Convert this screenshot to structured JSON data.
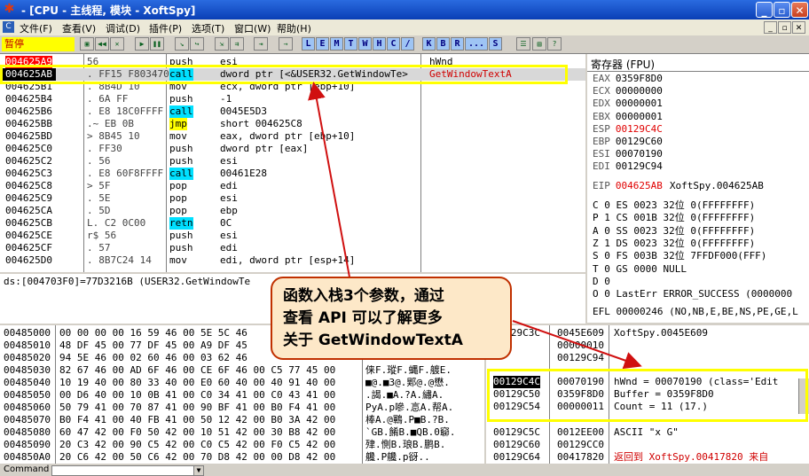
{
  "title_bar": {
    "title": "- [CPU - 主线程, 模块 - XoftSpy]",
    "minimize": "_",
    "restore": "▫",
    "close": "✕"
  },
  "menu": {
    "items": [
      "文件(F)",
      "查看(V)",
      "调试(D)",
      "插件(P)",
      "选项(T)",
      "窗口(W)",
      "帮助(H)"
    ]
  },
  "toolbar": {
    "status": "暂停",
    "letters": [
      "L",
      "E",
      "M",
      "T",
      "W",
      "H",
      "C",
      "/",
      "K",
      "B",
      "R",
      "...",
      "S"
    ]
  },
  "disasm": {
    "rows": [
      {
        "addr": "004625A9",
        "hex": "  56",
        "mn": "push",
        "opr": "esi",
        "cmt": "hWnd"
      },
      {
        "addr": "004625AB",
        "hex": ".  FF15 F8034700",
        "mn": "call",
        "opr": "dword ptr [<&USER32.GetWindowTe>",
        "cmt": "GetWindowTextA"
      },
      {
        "addr": "004625B1",
        "hex": ".  8B4D 10",
        "mn": "mov",
        "opr": "ecx, dword ptr [ebp+10]",
        "cmt": ""
      },
      {
        "addr": "004625B4",
        "hex": ".  6A FF",
        "mn": "push",
        "opr": "-1",
        "cmt": ""
      },
      {
        "addr": "004625B6",
        "hex": ".  E8 18C0FFFF",
        "mn": "call",
        "opr": "0045E5D3",
        "cmt": ""
      },
      {
        "addr": "004625BB",
        "hex": ".~ EB 0B",
        "mn": "jmp",
        "opr": "short 004625C8",
        "cmt": ""
      },
      {
        "addr": "004625BD",
        "hex": ">  8B45 10",
        "mn": "mov",
        "opr": "eax, dword ptr [ebp+10]",
        "cmt": ""
      },
      {
        "addr": "004625C0",
        "hex": ".  FF30",
        "mn": "push",
        "opr": "dword ptr [eax]",
        "cmt": ""
      },
      {
        "addr": "004625C2",
        "hex": ".  56",
        "mn": "push",
        "opr": "esi",
        "cmt": ""
      },
      {
        "addr": "004625C3",
        "hex": ".  E8 60F8FFFF",
        "mn": "call",
        "opr": "00461E28",
        "cmt": ""
      },
      {
        "addr": "004625C8",
        "hex": ">  5F",
        "mn": "pop",
        "opr": "edi",
        "cmt": ""
      },
      {
        "addr": "004625C9",
        "hex": ".  5E",
        "mn": "pop",
        "opr": "esi",
        "cmt": ""
      },
      {
        "addr": "004625CA",
        "hex": ".  5D",
        "mn": "pop",
        "opr": "ebp",
        "cmt": ""
      },
      {
        "addr": "004625CB",
        "hex": "L. C2 0C00",
        "mn": "retn",
        "opr": "0C",
        "cmt": ""
      },
      {
        "addr": "004625CE",
        "hex": "r$ 56",
        "mn": "push",
        "opr": "esi",
        "cmt": ""
      },
      {
        "addr": "004625CF",
        "hex": ".  57",
        "mn": "push",
        "opr": "edi",
        "cmt": ""
      },
      {
        "addr": "004625D0",
        "hex": ".  8B7C24 14",
        "mn": "mov",
        "opr": "edi, dword ptr [esp+14]",
        "cmt": ""
      }
    ]
  },
  "info_line": "ds:[004703F0]=77D3216B (USER32.GetWindowTe",
  "registers": {
    "header": "寄存器 (FPU)",
    "general": [
      {
        "name": "EAX",
        "val": "0359F8D0",
        "extra": ""
      },
      {
        "name": "ECX",
        "val": "00000000",
        "extra": ""
      },
      {
        "name": "EDX",
        "val": "00000001",
        "extra": ""
      },
      {
        "name": "EBX",
        "val": "00000001",
        "extra": ""
      },
      {
        "name": "ESP",
        "val": "00129C4C",
        "extra": ""
      },
      {
        "name": "EBP",
        "val": "00129C60",
        "extra": ""
      },
      {
        "name": "ESI",
        "val": "00070190",
        "extra": ""
      },
      {
        "name": "EDI",
        "val": "00129C94",
        "extra": ""
      }
    ],
    "eip": {
      "name": "EIP",
      "val": "004625AB",
      "extra": "XoftSpy.004625AB"
    },
    "flags": [
      "C 0  ES 0023 32位 0(FFFFFFFF)",
      "P 1  CS 001B 32位 0(FFFFFFFF)",
      "A 0  SS 0023 32位 0(FFFFFFFF)",
      "Z 1  DS 0023 32位 0(FFFFFFFF)",
      "S 0  FS 003B 32位 7FFDF000(FFF)",
      "T 0  GS 0000 NULL",
      "D 0",
      "O 0  LastErr ERROR_SUCCESS (0000000"
    ],
    "efl": "EFL 00000246 (NO,NB,E,BE,NS,PE,GE,L"
  },
  "dump": {
    "rows": [
      {
        "addr": "00485000",
        "hex": "00 00 00 00 16 59 46 00 5E 5C 46",
        "ascii": ""
      },
      {
        "addr": "00485010",
        "hex": "48 DF 45 00 77 DF 45 00 A9 DF 45",
        "ascii": ""
      },
      {
        "addr": "00485020",
        "hex": "94 5E 46 00 02 60 46 00 03 62 46",
        "ascii": ""
      },
      {
        "addr": "00485030",
        "hex": "82 67 46 00 AD 6F 46 00 CE 6F 46 00 C5 77 45 00",
        "ascii": "俫F.瑽F.蝿F.艔E."
      },
      {
        "addr": "00485040",
        "hex": "10 19 40 00 80 33 40 00 E0 60 40 00 40 91 40 00",
        "ascii": "■@.■3@.郹@.@懋."
      },
      {
        "addr": "00485050",
        "hex": "00 D6 40 00 10 0B 41 00 C0 34 41 00 C0 43 41 00",
        "ascii": ".謁.■A.?A.繡A."
      },
      {
        "addr": "00485060",
        "hex": "50 79 41 00 70 87 41 00 90 BF 41 00 B0 F4 41 00",
        "ascii": "PyA.p嘇.悥A.帮A."
      },
      {
        "addr": "00485070",
        "hex": "B0 F4 41 00 40 FB 41 00 50 12 42 00 B0 3A 42 00",
        "ascii": "棒A.@鶤.P■B.?B."
      },
      {
        "addr": "00485080",
        "hex": "60 47 42 00 F0 50 42 00 10 51 42 00 30 B8 42 00",
        "ascii": "`GB.餚B.■QB.0窷."
      },
      {
        "addr": "00485090",
        "hex": "20 C3 42 00 90 C5 42 00 C0 C5 42 00 F0 C5 42 00",
        "ascii": " 肂.惻B.琅B.鹏B."
      },
      {
        "addr": "004850A0",
        "hex": "20 C6 42 00 50 C6 42 00 70 D8 42 00 00 D8 42 00",
        "ascii": " 艬.P艬.p谺.."
      }
    ]
  },
  "stack": {
    "top_rows": [
      {
        "addr": "00129C3C",
        "val": "0045E609",
        "cmt": "XoftSpy.0045E609"
      },
      {
        "addr": "",
        "val": "00000010",
        "cmt": ""
      },
      {
        "addr": "",
        "val": "00129C94",
        "cmt": ""
      }
    ],
    "boxed_rows": [
      {
        "addr": "00129C4C",
        "val": "00070190",
        "cmt": "hWnd = 00070190 (class='Edit"
      },
      {
        "addr": "00129C50",
        "val": "0359F8D0",
        "cmt": "Buffer = 0359F8D0"
      },
      {
        "addr": "00129C54",
        "val": "00000011",
        "cmt": "Count = 11 (17.)"
      }
    ],
    "bottom_rows": [
      {
        "addr": "00129C5C",
        "val": "0012EE00",
        "cmt": "ASCII \"x G\""
      },
      {
        "addr": "00129C60",
        "val": "00129CC0",
        "cmt": ""
      },
      {
        "addr": "00129C64",
        "val": "00417820",
        "cmt": "返回到 XoftSpy.00417820 来自"
      }
    ]
  },
  "callout": {
    "line1": "函数入栈3个参数，通过",
    "line2": "查看 API 可以了解更多",
    "line3": "关于 GetWindowTextA"
  },
  "command": {
    "label": "Command"
  }
}
